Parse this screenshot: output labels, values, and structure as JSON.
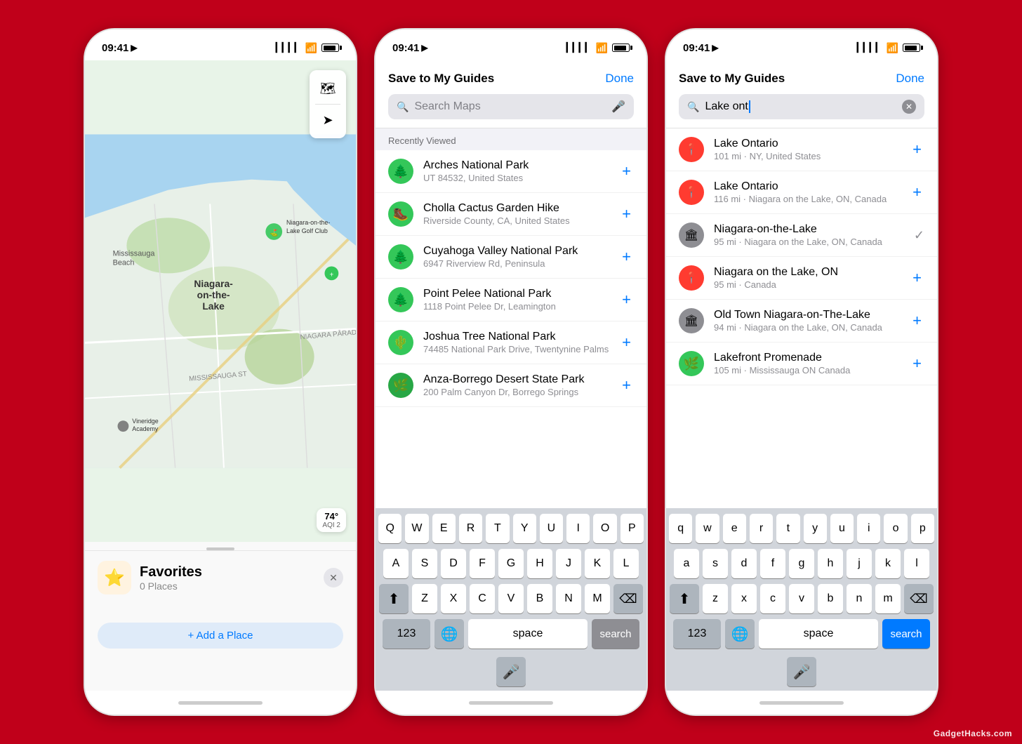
{
  "branding": "GadgetHacks.com",
  "phones": [
    {
      "id": "phone1",
      "statusBar": {
        "time": "09:41",
        "hasLocation": true
      },
      "map": {
        "weather": {
          "temp": "74°",
          "aqi": "AQI 2"
        }
      },
      "favoritesPanel": {
        "title": "Favorites",
        "count": "0 Places",
        "addPlaceLabel": "+ Add a Place"
      }
    },
    {
      "id": "phone2",
      "statusBar": {
        "time": "09:41",
        "hasLocation": true
      },
      "sheet": {
        "title": "Save to My Guides",
        "doneLabel": "Done",
        "searchPlaceholder": "Search Maps",
        "sectionLabel": "Recently Viewed",
        "items": [
          {
            "icon": "🌲",
            "iconType": "green",
            "title": "Arches National Park",
            "subtitle": "UT 84532, United States",
            "action": "plus"
          },
          {
            "icon": "🥾",
            "iconType": "green",
            "title": "Cholla Cactus Garden Hike",
            "subtitle": "Riverside County, CA, United States",
            "action": "plus"
          },
          {
            "icon": "🌲",
            "iconType": "green",
            "title": "Cuyahoga Valley National Park",
            "subtitle": "6947 Riverview Rd, Peninsula",
            "action": "plus"
          },
          {
            "icon": "🌲",
            "iconType": "green",
            "title": "Point Pelee National Park",
            "subtitle": "1118 Point Pelee Dr, Leamington",
            "action": "plus"
          },
          {
            "icon": "🌵",
            "iconType": "green",
            "title": "Joshua Tree National Park",
            "subtitle": "74485 National Park Drive, Twentynine Palms",
            "action": "plus"
          },
          {
            "icon": "🌿",
            "iconType": "green-dark",
            "title": "Anza-Borrego Desert State Park",
            "subtitle": "200 Palm Canyon Dr, Borrego Springs",
            "action": "plus"
          }
        ]
      },
      "keyboard": {
        "type": "uppercase",
        "searchLabel": "search"
      }
    },
    {
      "id": "phone3",
      "statusBar": {
        "time": "09:41",
        "hasLocation": true
      },
      "sheet": {
        "title": "Save to My Guides",
        "doneLabel": "Done",
        "searchText": "Lake ont",
        "items": [
          {
            "icon": "📍",
            "iconType": "red",
            "title": "Lake Ontario",
            "subtitle": "101 mi · NY, United States",
            "action": "plus"
          },
          {
            "icon": "📍",
            "iconType": "red",
            "title": "Lake Ontario",
            "subtitle": "116 mi · Niagara on the Lake, ON, Canada",
            "action": "plus"
          },
          {
            "icon": "🏛",
            "iconType": "gray",
            "title": "Niagara-on-the-Lake",
            "subtitle": "95 mi · Niagara on the Lake, ON, Canada",
            "action": "check"
          },
          {
            "icon": "📍",
            "iconType": "red",
            "title": "Niagara on the Lake, ON",
            "subtitle": "95 mi · Canada",
            "action": "plus"
          },
          {
            "icon": "🏛",
            "iconType": "gray",
            "title": "Old Town Niagara-on-The-Lake",
            "subtitle": "94 mi · Niagara on the Lake, ON, Canada",
            "action": "plus"
          },
          {
            "icon": "🌿",
            "iconType": "green",
            "title": "Lakefront Promenade",
            "subtitle": "105 mi · Mississauga ON Canada",
            "action": "plus"
          }
        ]
      },
      "keyboard": {
        "type": "lowercase",
        "searchLabel": "search"
      }
    }
  ]
}
